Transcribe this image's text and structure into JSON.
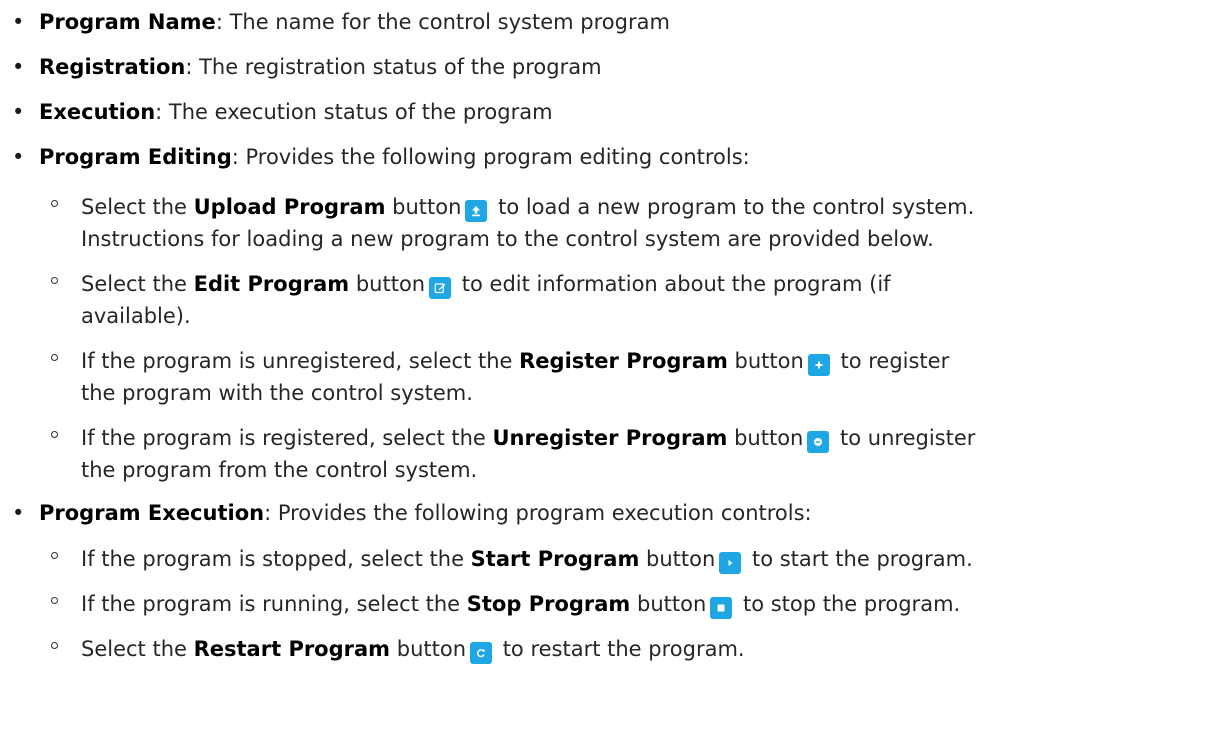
{
  "items": [
    {
      "term": "Program Name",
      "desc": ": The name for the control system program"
    },
    {
      "term": "Registration",
      "desc": ": The registration status of the program"
    },
    {
      "term": "Execution",
      "desc": ": The execution status of the program"
    },
    {
      "term": "Program Editing",
      "desc": ": Provides the following program editing controls:"
    },
    {
      "term": "Program Execution",
      "desc": ": Provides the following program execution controls:"
    }
  ],
  "editing": [
    {
      "pre": "Select the ",
      "kw": "Upload Program",
      "mid": " button",
      "icon": "upload-icon",
      "l1": " to load a new program to the control system.",
      "l2": "Instructions for loading a new program to the control system are provided below."
    },
    {
      "pre": "Select the ",
      "kw": "Edit Program",
      "mid": " button",
      "icon": "edit-icon",
      "l1": " to edit information about the program (if",
      "l2": "available)."
    },
    {
      "pre": "If the program is unregistered, select the ",
      "kw": "Register Program",
      "mid": " button",
      "icon": "plus-icon",
      "l1": " to register",
      "l2": "the program with the control system."
    },
    {
      "pre": "If the program is registered, select the ",
      "kw": "Unregister Program",
      "mid": " button",
      "icon": "minus-icon",
      "l1": " to unregister",
      "l2": "the program from the control system."
    }
  ],
  "execution": [
    {
      "pre": "If the program is stopped, select the ",
      "kw": "Start Program",
      "mid": " button",
      "icon": "play-icon",
      "l1": " to start the program."
    },
    {
      "pre": "If the program is running, select the ",
      "kw": "Stop Program",
      "mid": " button",
      "icon": "stop-icon",
      "l1": " to stop the program."
    },
    {
      "pre": "Select the ",
      "kw": "Restart Program",
      "mid": " button",
      "icon": "restart-icon",
      "l1": " to restart the program."
    }
  ],
  "colors": {
    "icon_button": "#1ea7e4",
    "text": "#262626"
  }
}
